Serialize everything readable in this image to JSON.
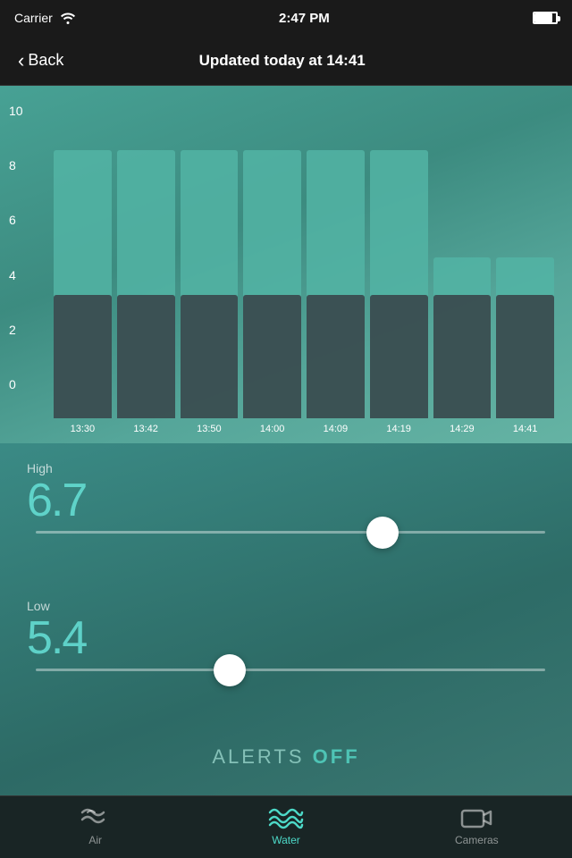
{
  "statusBar": {
    "carrier": "Carrier",
    "time": "2:47 PM"
  },
  "navBar": {
    "backLabel": "Back",
    "title": "Updated today at 14:41"
  },
  "chart": {
    "yLabels": [
      "0",
      "2",
      "4",
      "6",
      "8",
      "10"
    ],
    "xLabels": [
      "13:30",
      "13:42",
      "13:50",
      "14:00",
      "14:09",
      "14:19",
      "14:29",
      "14:41"
    ],
    "bars": [
      {
        "outer": 100,
        "inner": 46
      },
      {
        "outer": 100,
        "inner": 46
      },
      {
        "outer": 100,
        "inner": 46
      },
      {
        "outer": 100,
        "inner": 46
      },
      {
        "outer": 100,
        "inner": 46
      },
      {
        "outer": 100,
        "inner": 46
      },
      {
        "outer": 60,
        "inner": 46
      },
      {
        "outer": 60,
        "inner": 46
      }
    ]
  },
  "sliders": {
    "highLabel": "High",
    "highValue": "6.7",
    "highThumbPercent": 68,
    "lowLabel": "Low",
    "lowValue": "5.4",
    "lowThumbPercent": 38
  },
  "alerts": {
    "label": "ALERTS",
    "status": "OFF"
  },
  "tabBar": {
    "tabs": [
      {
        "id": "air",
        "label": "Air",
        "active": false
      },
      {
        "id": "water",
        "label": "Water",
        "active": true
      },
      {
        "id": "cameras",
        "label": "Cameras",
        "active": false
      }
    ]
  }
}
